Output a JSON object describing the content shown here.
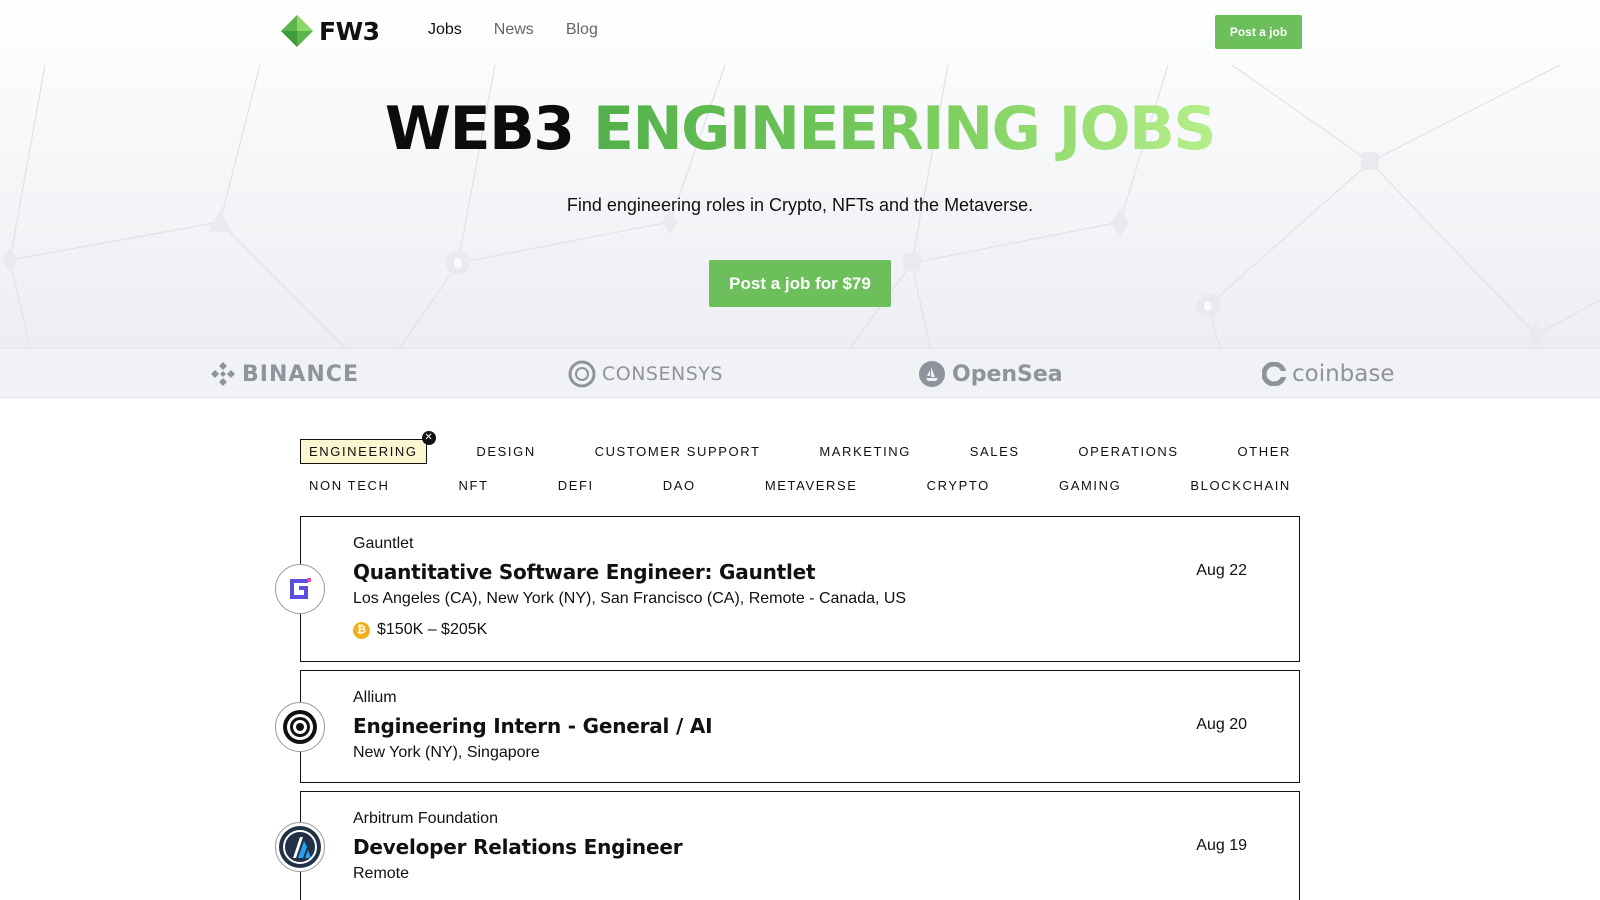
{
  "header": {
    "logo_text": "FW3",
    "nav": [
      {
        "label": "Jobs",
        "active": true
      },
      {
        "label": "News",
        "active": false
      },
      {
        "label": "Blog",
        "active": false
      }
    ],
    "post_job_label": "Post a job"
  },
  "hero": {
    "title_dark": "WEB3",
    "title_green": "ENGINEERING JOBS",
    "subtitle": "Find engineering roles in Crypto, NFTs and the Metaverse.",
    "cta_label": "Post a job for $79"
  },
  "companies": [
    {
      "name": "BINANCE",
      "icon": "binance-icon"
    },
    {
      "name": "CONSENSYS",
      "icon": "consensys-icon"
    },
    {
      "name": "OpenSea",
      "icon": "opensea-icon"
    },
    {
      "name": "coinbase",
      "icon": "coinbase-icon"
    }
  ],
  "categories": {
    "row1": [
      "ENGINEERING",
      "DESIGN",
      "CUSTOMER SUPPORT",
      "MARKETING",
      "SALES",
      "OPERATIONS",
      "OTHER"
    ],
    "row2": [
      "NON TECH",
      "NFT",
      "DEFI",
      "DAO",
      "METAVERSE",
      "CRYPTO",
      "GAMING",
      "BLOCKCHAIN"
    ],
    "selected": "ENGINEERING"
  },
  "jobs": [
    {
      "company": "Gauntlet",
      "title": "Quantitative Software Engineer: Gauntlet",
      "location": "Los Angeles (CA), New York (NY), San Francisco (CA), Remote - Canada, US",
      "salary": "$150K – $205K",
      "salary_icon": "bitcoin-coin-icon",
      "date": "Aug 22",
      "logo_icon": "gauntlet-logo-icon"
    },
    {
      "company": "Allium",
      "title": "Engineering Intern - General / AI",
      "location": "New York (NY), Singapore",
      "date": "Aug 20",
      "logo_icon": "allium-logo-icon"
    },
    {
      "company": "Arbitrum Foundation",
      "title": "Developer Relations Engineer",
      "location": "Remote",
      "date": "Aug 19",
      "logo_icon": "arbitrum-logo-icon"
    }
  ],
  "colors": {
    "brand_green": "#6cbf5a",
    "selected_tag_bg": "#fbf6cf",
    "strip_bg": "#f1f2f5",
    "logo_gray": "#8f939b"
  }
}
